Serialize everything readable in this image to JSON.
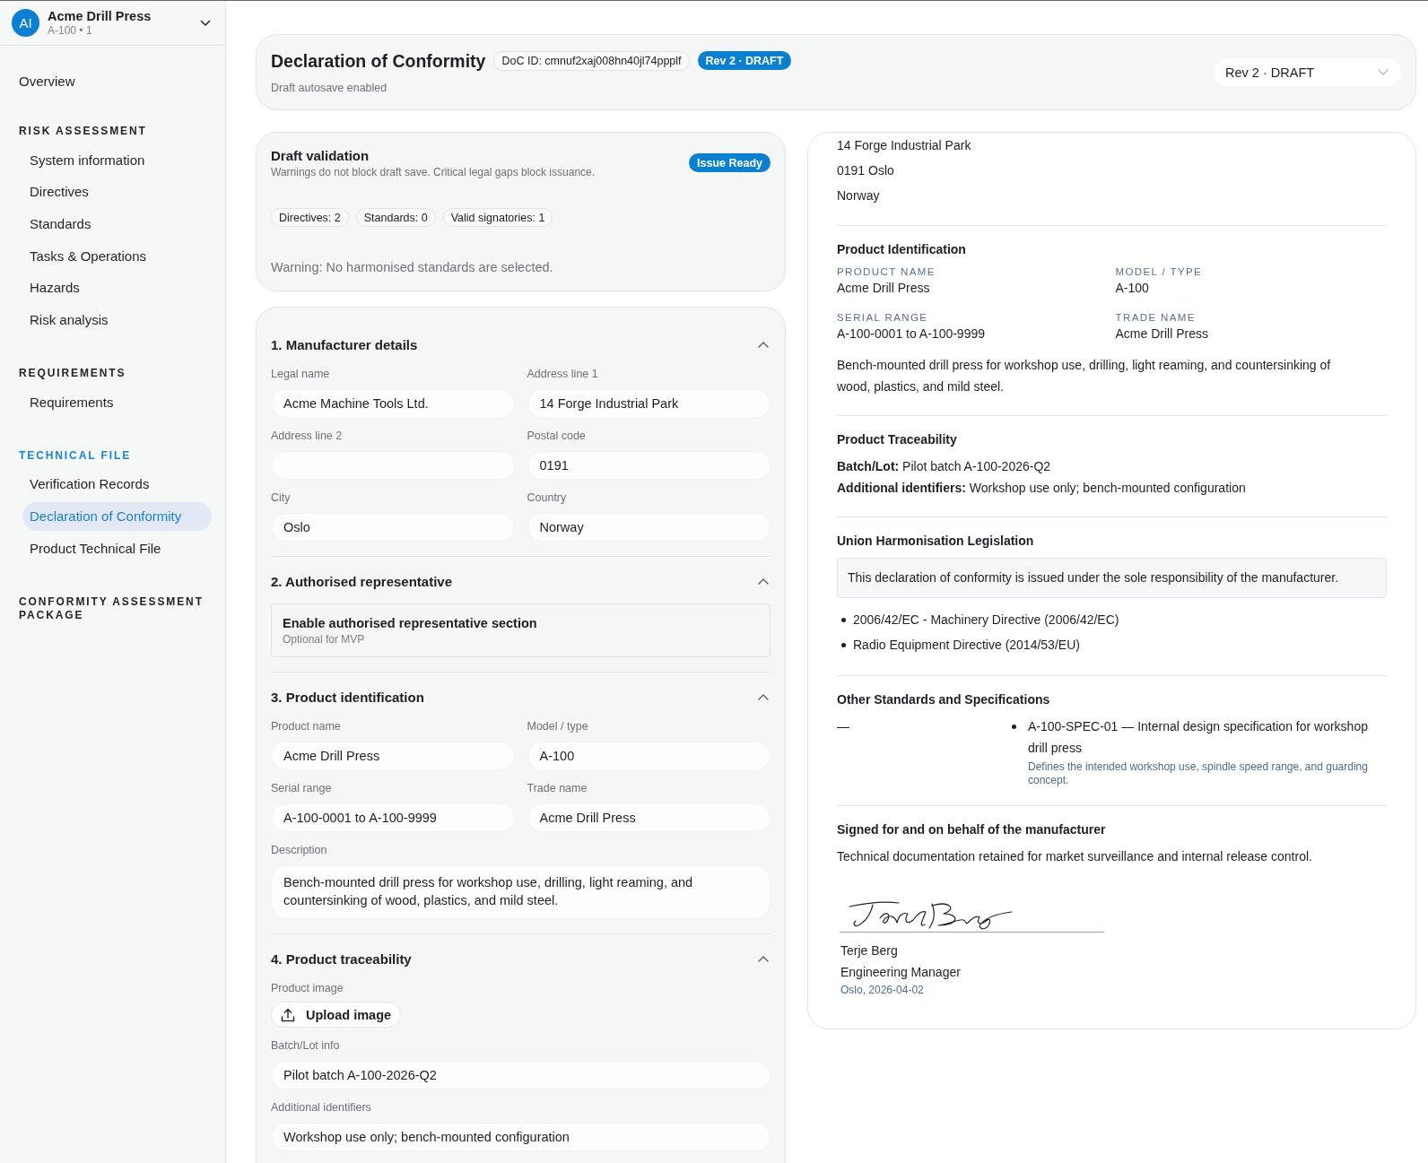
{
  "sidebar": {
    "project": {
      "initials": "AI",
      "name": "Acme Drill Press",
      "meta": "A-100 • 1"
    },
    "overview": {
      "label": "Overview",
      "selected": false
    },
    "groups": [
      {
        "title": "RISK ASSESSMENT",
        "active": false,
        "items": [
          {
            "label": "System information",
            "selected": false
          },
          {
            "label": "Directives",
            "selected": false
          },
          {
            "label": "Standards",
            "selected": false
          },
          {
            "label": "Tasks & Operations",
            "selected": false
          },
          {
            "label": "Hazards",
            "selected": false
          },
          {
            "label": "Risk analysis",
            "selected": false
          }
        ]
      },
      {
        "title": "REQUIREMENTS",
        "active": false,
        "items": [
          {
            "label": "Requirements",
            "selected": false
          }
        ]
      },
      {
        "title": "TECHNICAL FILE",
        "active": true,
        "items": [
          {
            "label": "Verification Records",
            "selected": false
          },
          {
            "label": "Declaration of Conformity",
            "selected": true
          },
          {
            "label": "Product Technical File",
            "selected": false
          }
        ]
      },
      {
        "title": "CONFORMITY ASSESSMENT PACKAGE",
        "active": false
      }
    ]
  },
  "header": {
    "title": "Declaration of Conformity",
    "doc_id": "DoC ID: cmnuf2xaj008hn40jl74ppplf",
    "status_badge": "Rev 2 · DRAFT",
    "subtitle": "Draft autosave enabled",
    "revision_select": {
      "value": "Rev 2 · DRAFT"
    }
  },
  "validation": {
    "title": "Draft validation",
    "description": "Warnings do not block draft save. Critical legal gaps block issuance.",
    "badge": "Issue Ready",
    "chips": [
      "Directives: 2",
      "Standards: 0",
      "Valid signatories: 1"
    ],
    "warning": "Warning: No harmonised standards are selected."
  },
  "form": {
    "sections": [
      {
        "title": "1. Manufacturer details",
        "expanded": true,
        "fields": [
          {
            "kind": "input",
            "label": "Legal name",
            "value": "Acme Machine Tools Ltd."
          },
          {
            "kind": "input",
            "label": "Address line 1",
            "value": "14 Forge Industrial Park"
          },
          {
            "kind": "input",
            "label": "Address line 2"
          },
          {
            "kind": "input",
            "label": "Postal code",
            "value": "0191"
          },
          {
            "kind": "input",
            "label": "City",
            "value": "Oslo"
          },
          {
            "kind": "input",
            "label": "Country",
            "value": "Norway"
          }
        ]
      },
      {
        "title": "2. Authorised representative",
        "expanded": true,
        "fields": [
          {
            "kind": "option",
            "title": "Enable authorised representative section",
            "hint": "Optional for MVP"
          }
        ]
      },
      {
        "title": "3. Product identification",
        "expanded": true,
        "fields": [
          {
            "kind": "input",
            "label": "Product name",
            "value": "Acme Drill Press"
          },
          {
            "kind": "input",
            "label": "Model / type",
            "value": "A-100"
          },
          {
            "kind": "input",
            "label": "Serial range",
            "value": "A-100-0001 to A-100-9999"
          },
          {
            "kind": "input",
            "label": "Trade name",
            "value": "Acme Drill Press"
          },
          {
            "kind": "textarea",
            "label": "Description",
            "value": "Bench-mounted drill press for workshop use, drilling, light reaming, and countersinking of wood, plastics, and mild steel."
          }
        ]
      },
      {
        "title": "4. Product traceability",
        "expanded": true,
        "fields": [
          {
            "kind": "upload",
            "label": "Product image",
            "button": "Upload image"
          },
          {
            "kind": "input",
            "wide": true,
            "label": "Batch/Lot info",
            "value": "Pilot batch A-100-2026-Q2"
          },
          {
            "kind": "input",
            "wide": true,
            "label": "Additional identifiers",
            "value": "Workshop use only; bench-mounted configuration"
          }
        ]
      }
    ]
  },
  "preview": {
    "address": [
      "14 Forge Industrial Park",
      "0191 Oslo",
      "Norway"
    ],
    "product_identification": {
      "title": "Product Identification",
      "fields": [
        {
          "label": "PRODUCT NAME",
          "value": "Acme Drill Press"
        },
        {
          "label": "MODEL / TYPE",
          "value": "A-100"
        },
        {
          "label": "SERIAL RANGE",
          "value": "A-100-0001 to A-100-9999"
        },
        {
          "label": "TRADE NAME",
          "value": "Acme Drill Press"
        }
      ],
      "description": "Bench-mounted drill press for workshop use, drilling, light reaming, and countersinking of wood, plastics, and mild steel."
    },
    "traceability": {
      "title": "Product Traceability",
      "lines": [
        "**Batch/Lot:** Pilot batch A-100-2026-Q2",
        "**Additional identifiers:** Workshop use only; bench-mounted configuration"
      ]
    },
    "legislation": {
      "title": "Union Harmonisation Legislation",
      "statement": "This declaration of conformity is issued under the sole responsibility of the manufacturer.",
      "directives": [
        "2006/42/EC - Machinery Directive (2006/42/EC)",
        "Radio Equipment Directive (2014/53/EU)"
      ]
    },
    "other_standards": {
      "title": "Other Standards and Specifications",
      "column_1": "—",
      "specifications": [
        {
          "name": "A-100-SPEC-01 — Internal design specification for workshop drill press",
          "note": "Defines the intended workshop use, spindle speed range, and guarding concept."
        }
      ]
    },
    "signature": {
      "title": "Signed for and on behalf of the manufacturer",
      "statement": "Technical documentation retained for market surveillance and internal release control.",
      "name": "Terje Berg",
      "role": "Engineering Manager",
      "place_date": "Oslo, 2026-04-02"
    }
  }
}
